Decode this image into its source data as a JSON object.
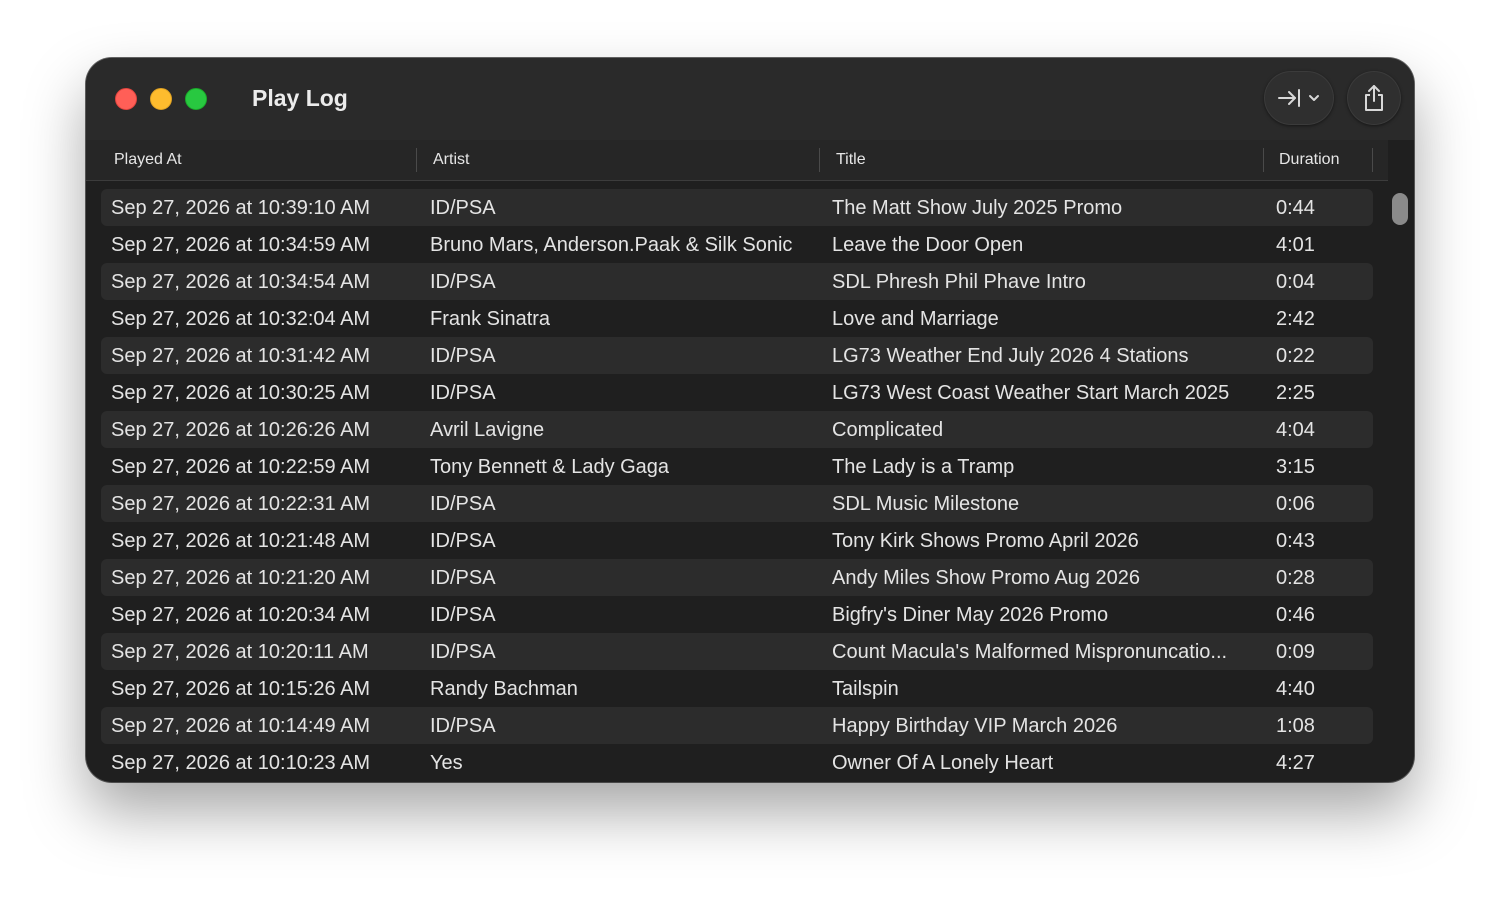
{
  "window": {
    "title": "Play Log"
  },
  "toolbar": {
    "jump_icon": "jump-to-latest-icon",
    "share_icon": "share-icon"
  },
  "columns": {
    "played_at": "Played At",
    "artist": "Artist",
    "title": "Title",
    "duration": "Duration"
  },
  "rows": [
    {
      "played_at": "Sep 27, 2026 at 10:39:10 AM",
      "artist": "ID/PSA",
      "title": "The Matt Show July 2025 Promo",
      "duration": "0:44"
    },
    {
      "played_at": "Sep 27, 2026 at 10:34:59 AM",
      "artist": "Bruno Mars, Anderson.Paak & Silk Sonic",
      "title": "Leave the Door Open",
      "duration": "4:01"
    },
    {
      "played_at": "Sep 27, 2026 at 10:34:54 AM",
      "artist": "ID/PSA",
      "title": "SDL Phresh Phil Phave Intro",
      "duration": "0:04"
    },
    {
      "played_at": "Sep 27, 2026 at 10:32:04 AM",
      "artist": "Frank Sinatra",
      "title": "Love and Marriage",
      "duration": "2:42"
    },
    {
      "played_at": "Sep 27, 2026 at 10:31:42 AM",
      "artist": "ID/PSA",
      "title": "LG73 Weather End July 2026 4 Stations",
      "duration": "0:22"
    },
    {
      "played_at": "Sep 27, 2026 at 10:30:25 AM",
      "artist": "ID/PSA",
      "title": "LG73 West Coast Weather Start March 2025",
      "duration": "2:25"
    },
    {
      "played_at": "Sep 27, 2026 at 10:26:26 AM",
      "artist": "Avril Lavigne",
      "title": "Complicated",
      "duration": "4:04"
    },
    {
      "played_at": "Sep 27, 2026 at 10:22:59 AM",
      "artist": "Tony Bennett & Lady Gaga",
      "title": "The Lady is a Tramp",
      "duration": "3:15"
    },
    {
      "played_at": "Sep 27, 2026 at 10:22:31 AM",
      "artist": "ID/PSA",
      "title": "SDL Music Milestone",
      "duration": "0:06"
    },
    {
      "played_at": "Sep 27, 2026 at 10:21:48 AM",
      "artist": "ID/PSA",
      "title": "Tony Kirk Shows Promo April 2026",
      "duration": "0:43"
    },
    {
      "played_at": "Sep 27, 2026 at 10:21:20 AM",
      "artist": "ID/PSA",
      "title": "Andy Miles Show Promo Aug 2026",
      "duration": "0:28"
    },
    {
      "played_at": "Sep 27, 2026 at 10:20:34 AM",
      "artist": "ID/PSA",
      "title": "Bigfry's Diner May 2026 Promo",
      "duration": "0:46"
    },
    {
      "played_at": "Sep 27, 2026 at 10:20:11 AM",
      "artist": "ID/PSA",
      "title": "Count Macula's Malformed Mispronuncatio...",
      "duration": "0:09"
    },
    {
      "played_at": "Sep 27, 2026 at 10:15:26 AM",
      "artist": "Randy Bachman",
      "title": "Tailspin",
      "duration": "4:40"
    },
    {
      "played_at": "Sep 27, 2026 at 10:14:49 AM",
      "artist": "ID/PSA",
      "title": "Happy Birthday VIP March 2026",
      "duration": "1:08"
    },
    {
      "played_at": "Sep 27, 2026 at 10:10:23 AM",
      "artist": "Yes",
      "title": "Owner Of A Lonely Heart",
      "duration": "4:27"
    }
  ],
  "colors": {
    "window_bg": "#1f1f1f",
    "row_alt": "#2c2c2c",
    "close": "#ff5f57",
    "minimize": "#febc2e",
    "zoom": "#28c840"
  }
}
